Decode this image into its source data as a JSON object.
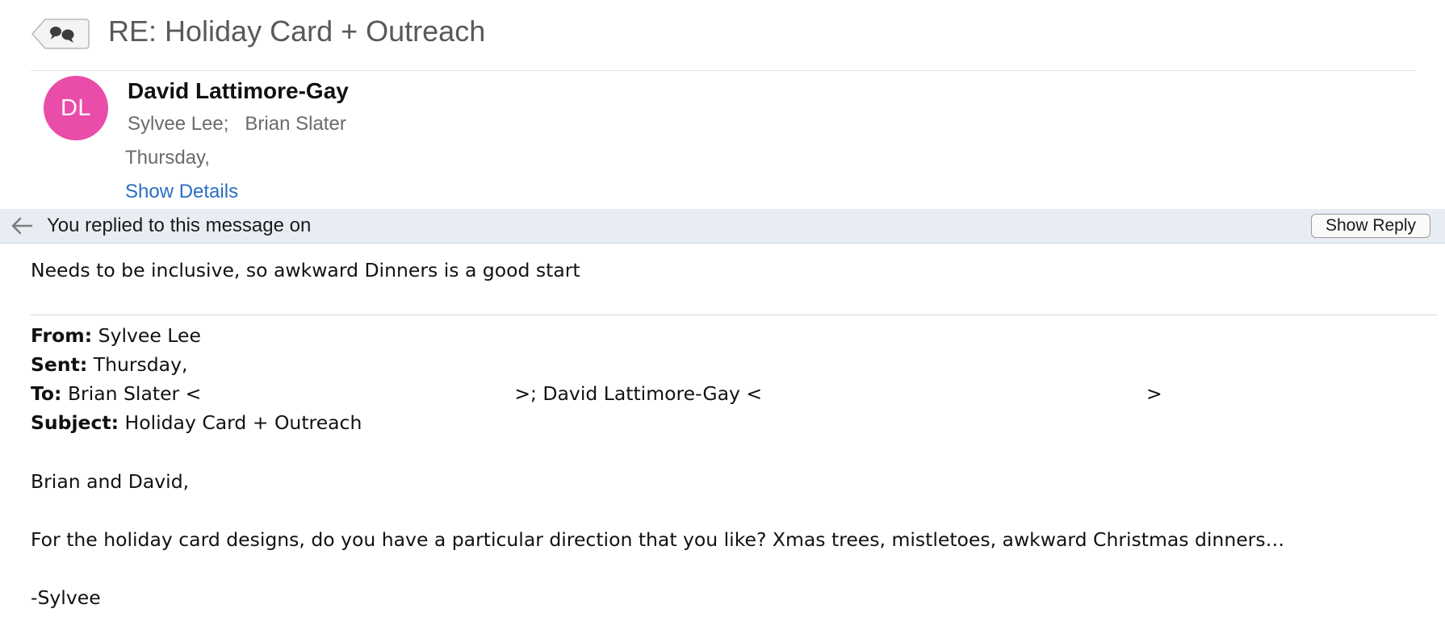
{
  "header": {
    "subject": "RE: Holiday Card + Outreach",
    "conversation_icon": "speech-bubbles-icon"
  },
  "sender": {
    "initials": "DL",
    "avatar_color": "#ea4ca9",
    "name": "David Lattimore-Gay",
    "recipients": [
      "Sylvee Lee;",
      "Brian Slater"
    ],
    "date": "Thursday,",
    "show_details_label": "Show Details",
    "link_color": "#2a6fc2"
  },
  "replied_banner": {
    "text": "You replied to this message on",
    "show_reply_label": "Show Reply",
    "icon": "back-arrow-icon"
  },
  "message": {
    "reply_text": "Needs to be inclusive, so awkward Dinners is a good start",
    "quoted_header": {
      "from_label": "From:",
      "from_value": "Sylvee Lee",
      "sent_label": "Sent:",
      "sent_value": "Thursday,",
      "to_label": "To:",
      "to_value": "Brian Slater <",
      "to_value_2": ">; David Lattimore-Gay <",
      "to_value_end": ">",
      "subject_label": "Subject:",
      "subject_value": "Holiday Card + Outreach"
    },
    "greeting": "Brian and David,",
    "paragraph": "For the holiday card designs, do you have a particular direction that you like?  Xmas trees, mistletoes, awkward Christmas dinners…",
    "signoff": "-Sylvee"
  }
}
